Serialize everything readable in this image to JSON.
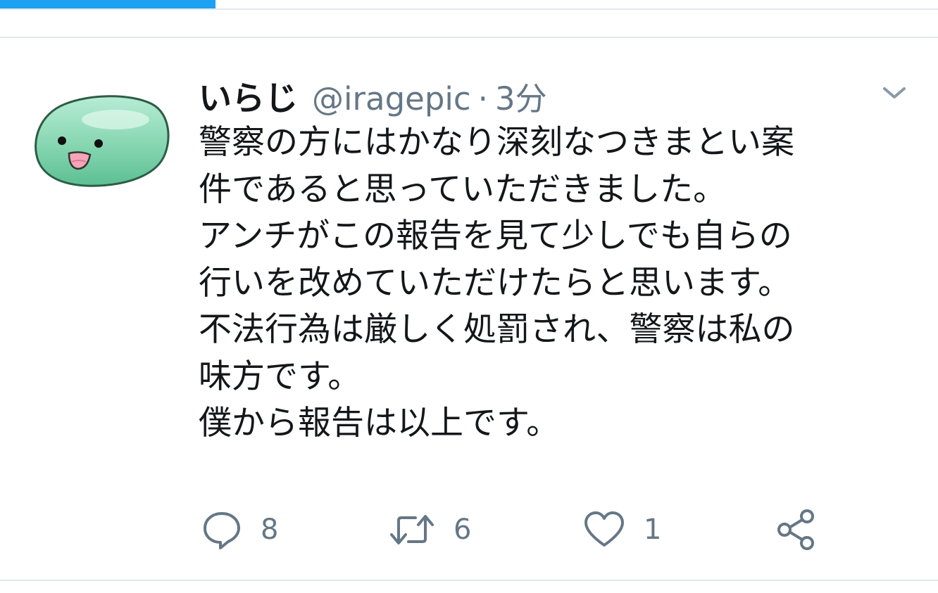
{
  "colors": {
    "accent": "#1da1f2",
    "text": "#14171a",
    "muted": "#657786",
    "divider": "#e1e8ed",
    "avatar_body": "#8fd9b8"
  },
  "loading_progress": 0.23,
  "tweet": {
    "author_name": "いらじ",
    "handle": "@iragepic",
    "separator": "·",
    "time": "3分",
    "lines": [
      "警察の方にはかなり深刻なつきまとい案",
      "件であると思っていただきました。",
      "アンチがこの報告を見て少しでも自らの",
      "行いを改めていただけたらと思います。",
      "不法行為は厳しく処罰され、警察は私の",
      "味方です。",
      "僕から報告は以上です。"
    ],
    "actions": {
      "reply_count": "8",
      "retweet_count": "6",
      "like_count": "1"
    }
  },
  "icons": [
    "avatar-slime",
    "chevron-down-icon",
    "reply-icon",
    "retweet-icon",
    "like-icon",
    "share-icon"
  ]
}
